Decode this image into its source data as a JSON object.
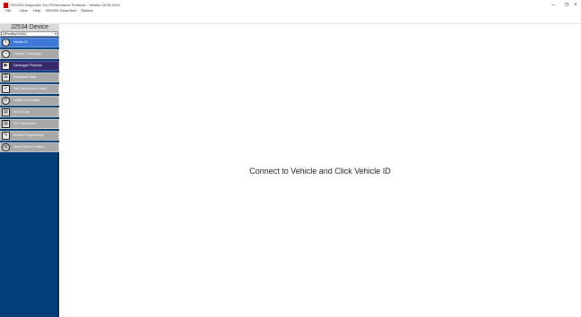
{
  "window": {
    "title": "ROUSH Diagnostic Tool Performance Products - Version 20.05.0019",
    "minimize_glyph": "–",
    "maximize_glyph": "❐",
    "close_glyph": "×"
  },
  "menu": [
    "File",
    "View",
    "Help",
    "ROUSH CleanTech",
    "Options"
  ],
  "sidebar": {
    "device_label": "J2534 Device",
    "device_value": "DPedMyCHNC",
    "items": [
      {
        "label": "Vehicle ID",
        "icon": "info-icon",
        "glyph": "i",
        "state": "active"
      },
      {
        "label": "Gauges / Dashpage",
        "icon": "gauge-icon",
        "glyph": "◔",
        "state": "normal"
      },
      {
        "label": "Datalogger Playback",
        "icon": "play-icon",
        "glyph": "▶",
        "state": "playback"
      },
      {
        "label": "Functional Tests",
        "icon": "list-icon",
        "glyph": "☰",
        "state": "normal"
      },
      {
        "label": "Self Tests (Error Codes)",
        "icon": "checkmark-icon",
        "glyph": "✓",
        "state": "normal"
      },
      {
        "label": "Vehicle Information",
        "icon": "magnifier-icon",
        "glyph": "⚲",
        "state": "normal"
      },
      {
        "label": "End of Line",
        "icon": "document-icon",
        "glyph": "▤",
        "state": "normal"
      },
      {
        "label": "VID Parameters",
        "icon": "parameters-icon",
        "glyph": "▥",
        "state": "normal"
      },
      {
        "label": "Module Programming",
        "icon": "wrench-icon",
        "glyph": "✎",
        "state": "normal"
      },
      {
        "label": "Share Data w/ Hotline",
        "icon": "globe-icon",
        "glyph": "◍",
        "state": "normal"
      }
    ]
  },
  "main": {
    "message": "Connect to Vehicle and Click Vehicle ID"
  }
}
